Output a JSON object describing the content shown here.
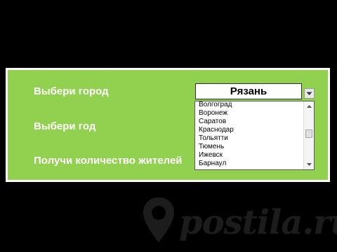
{
  "form": {
    "city_label": "Выбери город",
    "year_label": "Выбери год",
    "population_label": "Получи количество жителей",
    "selected_city": "Рязань"
  },
  "dropdown": {
    "options": [
      "Волгоград",
      "Воронеж",
      "Саратов",
      "Краснодар",
      "Тольятти",
      "Тюмень",
      "Ижевск",
      "Барнаул"
    ],
    "scroll_position": 0.45
  },
  "watermark": {
    "text": "postila.ru"
  },
  "colors": {
    "background": "#000000",
    "panel_fill": "#92d050",
    "panel_border": "#ffffff",
    "label_text": "#ffffff"
  }
}
